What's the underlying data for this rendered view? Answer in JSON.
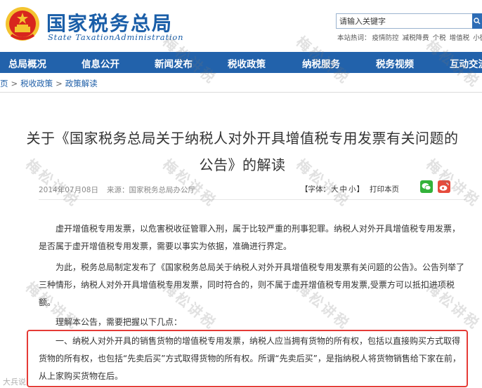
{
  "header": {
    "logo_cn": "国家税务总局",
    "logo_en": "State TaxationAdministration",
    "search_placeholder": "请输入关键字",
    "hot_label": "本站热词：",
    "hot_words": [
      "疫情防控",
      "减税降费",
      "个税",
      "增值税",
      "小微企业"
    ]
  },
  "nav": {
    "items": [
      "总局概况",
      "信息公开",
      "新闻发布",
      "税收政策",
      "纳税服务",
      "税务视频",
      "互动交流"
    ]
  },
  "breadcrumb": {
    "items": [
      "页",
      "税收政策",
      "政策解读"
    ]
  },
  "article": {
    "title": "关于《国家税务总局关于纳税人对外开具增值税专用发票有关问题的公告》的解读",
    "date": "2014年07月08日",
    "source": "来源：国家税务总局办公厅",
    "font_label": "【字体：",
    "font_sizes": [
      "大",
      "中",
      "小"
    ],
    "font_close": "】",
    "print_label": "打印本页",
    "paragraphs": [
      "虚开增值税专用发票，以危害税收征管罪入刑，属于比较严重的刑事犯罪。纳税人对外开具增值税专用发票，是否属于虚开增值税专用发票，需要以事实为依据，准确进行界定。",
      "为此，税务总局制定发布了《国家税务总局关于纳税人对外开具增值税专用发票有关问题的公告》。公告列举了三种情形，纳税人对外开具增值税专用发票，同时符合的，则不属于虚开增值税专用发票,受票方可以抵扣进项税额。",
      "理解本公告，需要把握以下几点：",
      "一、纳税人对外开具的销售货物的增值税专用发票，纳税人应当拥有货物的所有权，包括以直接购买方式取得货物的所有权，也包括“先卖后买”方式取得货物的所有权。所谓“先卖后买”，是指纳税人将货物销售给下家在前，从上家购买货物在后。"
    ]
  },
  "watermark": {
    "text": "梅松讲税",
    "corner": "大兵说"
  },
  "colors": {
    "brand_blue": "#1a5ea8",
    "nav_blue": "#2262ab",
    "highlight_red": "#e53b36",
    "wechat_green": "#33b23a",
    "weibo_red": "#e64b3c"
  },
  "icons": [
    "national-emblem-icon",
    "search-icon",
    "wechat-icon",
    "weibo-icon"
  ]
}
